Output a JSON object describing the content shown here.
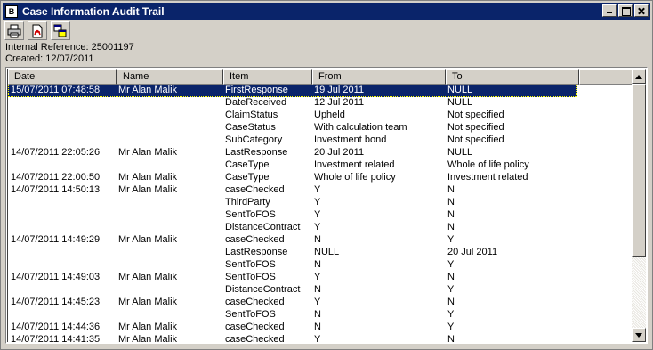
{
  "window": {
    "title": "Case Information Audit Trail"
  },
  "toolbar": {
    "buttons": [
      {
        "icon": "printer-icon"
      },
      {
        "icon": "pdf-icon"
      },
      {
        "icon": "copy-windows-icon"
      }
    ]
  },
  "info": {
    "reference": "Internal Reference: 25001197",
    "created": "Created: 12/07/2011"
  },
  "table": {
    "columns": [
      "Date",
      "Name",
      "Item",
      "From",
      "To"
    ],
    "rows": [
      {
        "date": "15/07/2011 07:48:58",
        "name": "Mr Alan Malik",
        "item": "FirstResponse",
        "from": "19 Jul 2011",
        "to": "NULL",
        "selected": true
      },
      {
        "date": "",
        "name": "",
        "item": "DateReceived",
        "from": "12 Jul 2011",
        "to": "NULL"
      },
      {
        "date": "",
        "name": "",
        "item": "ClaimStatus",
        "from": "Upheld",
        "to": "Not specified"
      },
      {
        "date": "",
        "name": "",
        "item": "CaseStatus",
        "from": "With calculation team",
        "to": "Not specified"
      },
      {
        "date": "",
        "name": "",
        "item": "SubCategory",
        "from": "Investment bond",
        "to": "Not specified"
      },
      {
        "date": "14/07/2011 22:05:26",
        "name": "Mr Alan Malik",
        "item": "LastResponse",
        "from": "20 Jul 2011",
        "to": "NULL"
      },
      {
        "date": "",
        "name": "",
        "item": "CaseType",
        "from": "Investment related",
        "to": "Whole of life policy"
      },
      {
        "date": "14/07/2011 22:00:50",
        "name": "Mr Alan Malik",
        "item": "CaseType",
        "from": "Whole of life policy",
        "to": "Investment related"
      },
      {
        "date": "14/07/2011 14:50:13",
        "name": "Mr Alan Malik",
        "item": "caseChecked",
        "from": "Y",
        "to": "N"
      },
      {
        "date": "",
        "name": "",
        "item": "ThirdParty",
        "from": "Y",
        "to": "N"
      },
      {
        "date": "",
        "name": "",
        "item": "SentToFOS",
        "from": "Y",
        "to": "N"
      },
      {
        "date": "",
        "name": "",
        "item": "DistanceContract",
        "from": "Y",
        "to": "N"
      },
      {
        "date": "14/07/2011 14:49:29",
        "name": "Mr Alan Malik",
        "item": "caseChecked",
        "from": "N",
        "to": "Y"
      },
      {
        "date": "",
        "name": "",
        "item": "LastResponse",
        "from": "NULL",
        "to": "20 Jul 2011"
      },
      {
        "date": "",
        "name": "",
        "item": "SentToFOS",
        "from": "N",
        "to": "Y"
      },
      {
        "date": "14/07/2011 14:49:03",
        "name": "Mr Alan Malik",
        "item": "SentToFOS",
        "from": "Y",
        "to": "N"
      },
      {
        "date": "",
        "name": "",
        "item": "DistanceContract",
        "from": "N",
        "to": "Y"
      },
      {
        "date": "14/07/2011 14:45:23",
        "name": "Mr Alan Malik",
        "item": "caseChecked",
        "from": "Y",
        "to": "N"
      },
      {
        "date": "",
        "name": "",
        "item": "SentToFOS",
        "from": "N",
        "to": "Y"
      },
      {
        "date": "14/07/2011 14:44:36",
        "name": "Mr Alan Malik",
        "item": "caseChecked",
        "from": "N",
        "to": "Y"
      },
      {
        "date": "14/07/2011 14:41:35",
        "name": "Mr Alan Malik",
        "item": "caseChecked",
        "from": "Y",
        "to": "N"
      }
    ]
  },
  "scrollbar": {
    "position": 0.0
  },
  "colors": {
    "titlebar": "#0a246a",
    "selection": "#0a246a",
    "face": "#d4d0c8"
  }
}
